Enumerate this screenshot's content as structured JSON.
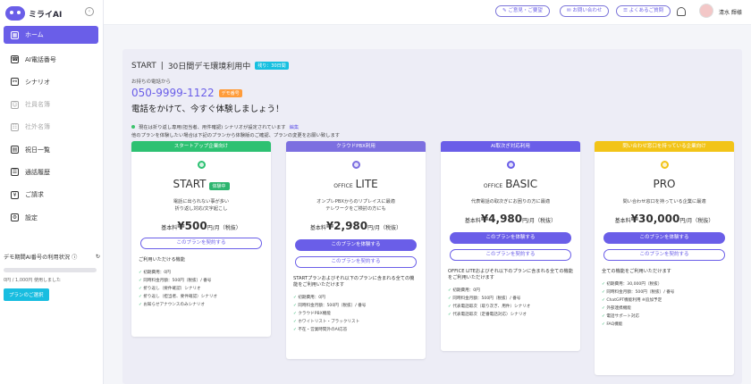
{
  "app": {
    "logo_text": "ミライAI"
  },
  "sidebar": {
    "items": [
      {
        "label": "ホーム",
        "icon": "home-icon",
        "glyph": "▦"
      },
      {
        "label": "AI電話番号",
        "icon": "phone-icon",
        "glyph": "☎"
      },
      {
        "label": "シナリオ",
        "icon": "scenario-icon",
        "glyph": "⚯"
      },
      {
        "label": "社員名簿",
        "icon": "staff-icon",
        "glyph": "☺"
      },
      {
        "label": "社外名簿",
        "icon": "contacts-icon",
        "glyph": "☷"
      },
      {
        "label": "祝日一覧",
        "icon": "calendar-icon",
        "glyph": "▤"
      },
      {
        "label": "通話履歴",
        "icon": "history-icon",
        "glyph": "☰"
      },
      {
        "label": "ご請求",
        "icon": "invoice-icon",
        "glyph": "¥"
      },
      {
        "label": "設定",
        "icon": "settings-icon",
        "glyph": "⚙"
      }
    ],
    "usage_title": "デモ期間AI番号の利用状況 ⓘ",
    "usage_text": "0円 / 1,000円 使用しました",
    "usage_percent": 0,
    "plan_button": "プランのご選択"
  },
  "topbar": {
    "feedback": "✎ ご意見・ご要望",
    "contact": "✉ お問い合わせ",
    "faq": "☰ よくあるご質問",
    "user_name": "清水 輝様"
  },
  "demo": {
    "title_prefix": "START",
    "title": "30日間デモ環境利用中",
    "days_tag": "残り：30日間",
    "phone_label": "お持ちの電話から",
    "phone_number": "050-9999-1122",
    "phone_tag": "デモ番号",
    "call_message": "電話をかけて、今すぐ体験しましょう！",
    "note1": "現在は折り返し専用(担当者、用件確認) シナリオが設定されています",
    "edit_link": "編集",
    "note2": "他のプランを体験したい場合は下記のプランから体験版のご確認、プランの変更をお願い致します"
  },
  "plans": [
    {
      "header": "スタートアップ企業向け",
      "color": "#2dc172",
      "name_small": "",
      "name": "START",
      "trial_badge": "体験中",
      "desc1": "電話に出られない事が多い",
      "desc2": "折り返し対応/文字起こし",
      "price_prefix": "基本料",
      "price": "¥500",
      "price_suffix": "円/月（税抜）",
      "trial_btn": "",
      "contract_btn": "このプランを契約する",
      "feature_title": "ご利用いただける機能",
      "features": [
        "初期費用：0円",
        "同時料金月額：500円（税抜）/ 番号",
        "折り返し（要件確認）シナリオ",
        "折り返し（担当者、要件確認）シナリオ",
        "お知らせアナウンスのみシナリオ"
      ]
    },
    {
      "header": "クラウドPBX利用",
      "color": "#7c6fe0",
      "name_small": "OFFICE",
      "name": "LITE",
      "trial_badge": "",
      "desc1": "オンプレPBXからのリプレイスに最適",
      "desc2": "テレワークをご検討の方にも",
      "price_prefix": "基本料",
      "price": "¥2,980",
      "price_suffix": "円/月（税抜）",
      "trial_btn": "このプランを体験する",
      "contract_btn": "このプランを契約する",
      "feature_title": "STARTプランおよびそれ以下のプランに含まれる全ての機能をご利用いただけます",
      "features": [
        "初期費用：0円",
        "同時料金月額：500円（税抜）/ 番号",
        "クラウドPBX機能",
        "ホワイトリスト・ブラックリスト",
        "不在・営業時間外のAI応答"
      ]
    },
    {
      "header": "AI取次ぎ対応利用",
      "color": "#6a5ee8",
      "name_small": "OFFICE",
      "name": "BASIC",
      "trial_badge": "",
      "desc1": "代表電話の取次ぎにお困りの方に最適",
      "desc2": "",
      "price_prefix": "基本料",
      "price": "¥4,980",
      "price_suffix": "円/月（税抜）",
      "trial_btn": "このプランを体験する",
      "contract_btn": "このプランを契約する",
      "feature_title": "OFFICE LITEおよびそれ以下のプランに含まれる全ての機能をご利用いただけます",
      "features": [
        "初期費用：0円",
        "同時料金月額：500円（税抜）/ 番号",
        "代表電話取次（取り次ぎ、用件）シナリオ",
        "代表電話取次（定番電話対応）シナリオ"
      ]
    },
    {
      "header": "問い合わせ窓口を持っている企業向け",
      "color": "#f2c418",
      "name_small": "",
      "name": "PRO",
      "trial_badge": "",
      "desc1": "問い合わせ窓口を持っている企業に最適",
      "desc2": "",
      "price_prefix": "基本料",
      "price": "¥30,000",
      "price_suffix": "円/月（税抜）",
      "trial_btn": "このプランを体験する",
      "contract_btn": "このプランを契約する",
      "feature_title": "全ての機能をご利用いただけます",
      "features": [
        "初期費用：30,000円（税抜）",
        "同時料金月額：500円（税抜）/ 番号",
        "ChatGPT機能利用 ※追加予定",
        "外部連携機能",
        "電話サポート対応",
        "FAQ機能"
      ]
    }
  ]
}
